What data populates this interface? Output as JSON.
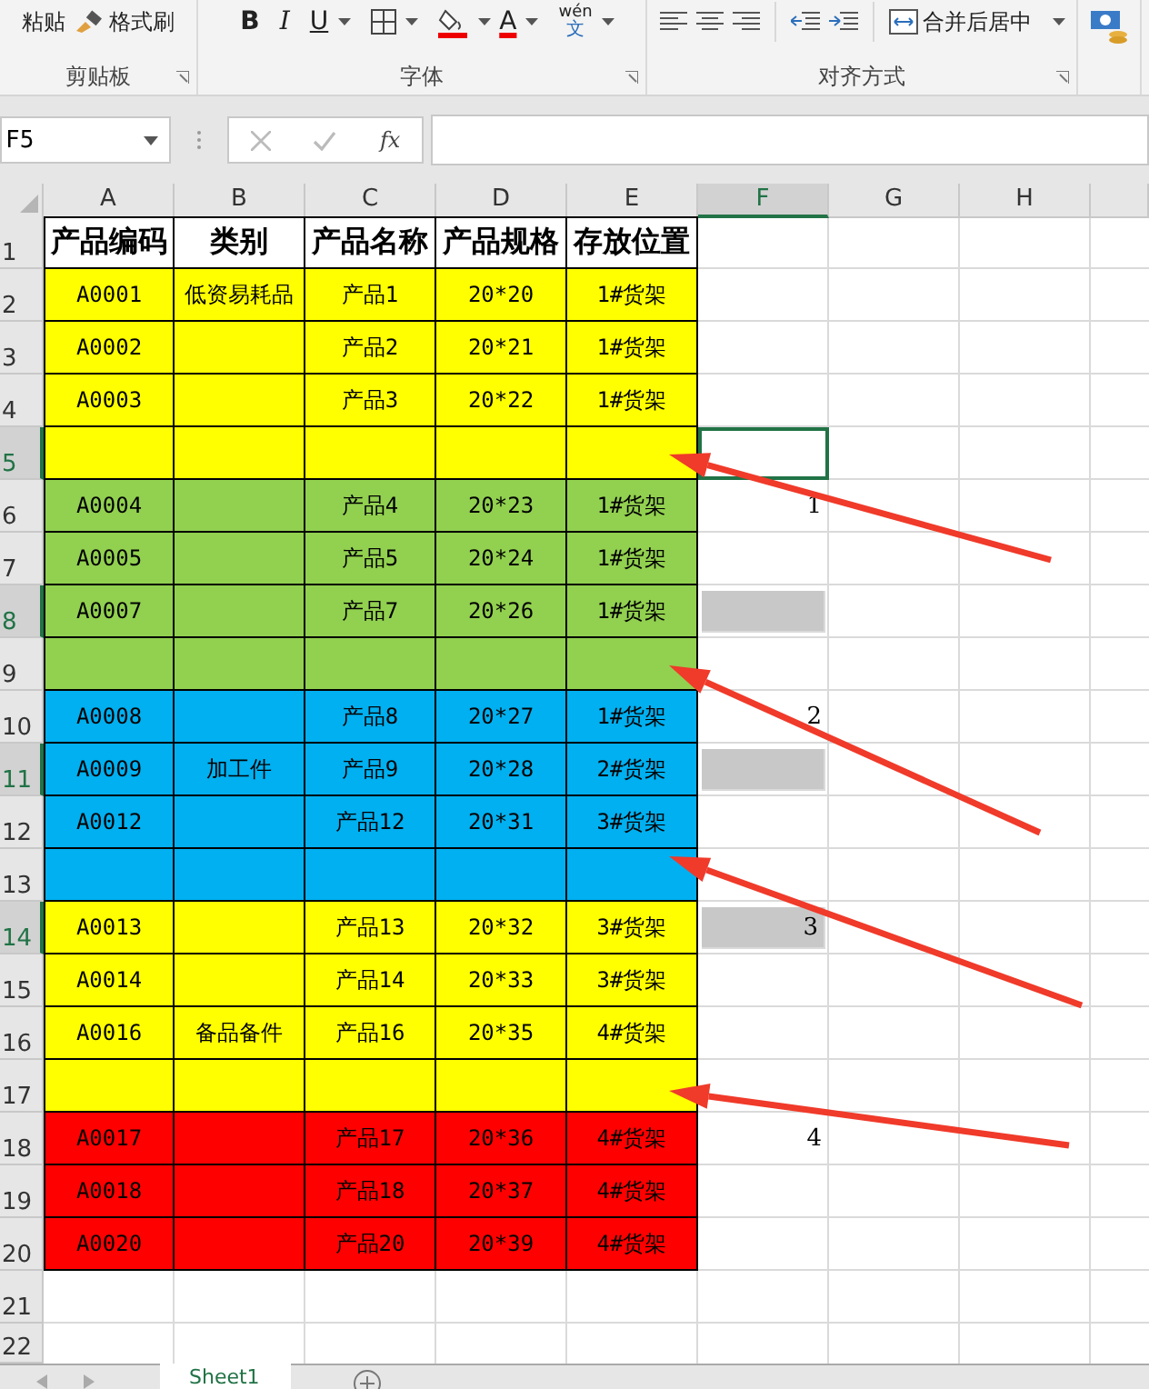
{
  "ribbon": {
    "paste": "粘贴",
    "format_painter": "格式刷",
    "bold": "B",
    "italic": "I",
    "underline": "U",
    "font_color": "A",
    "phonetic": "wén",
    "phonetic_char": "文",
    "merge": "合并后居中",
    "groups": [
      "剪贴板",
      "字体",
      "对齐方式"
    ]
  },
  "formula_bar": {
    "name_box": "F5",
    "function_label": "fx"
  },
  "columns": [
    {
      "label": "A",
      "selected": false
    },
    {
      "label": "B",
      "selected": false
    },
    {
      "label": "C",
      "selected": false
    },
    {
      "label": "D",
      "selected": false
    },
    {
      "label": "E",
      "selected": false
    },
    {
      "label": "F",
      "selected": true
    },
    {
      "label": "G",
      "selected": false
    },
    {
      "label": "H",
      "selected": false
    }
  ],
  "header_row": {
    "number": "1",
    "cells": [
      "产品编码",
      "类别",
      "产品名称",
      "产品规格",
      "存放位置"
    ]
  },
  "rows": [
    {
      "number": "2",
      "color": "#ffff00",
      "a": "A0001",
      "b": "低资易耗品",
      "c": "产品1",
      "d": "20*20",
      "e": "1#货架",
      "selected": false,
      "f_active": false,
      "f_shaded": false,
      "arrow": false
    },
    {
      "number": "3",
      "color": "#ffff00",
      "a": "A0002",
      "c": "产品2",
      "d": "20*21",
      "e": "1#货架",
      "selected": false,
      "f_active": false,
      "f_shaded": false,
      "arrow": false
    },
    {
      "number": "4",
      "color": "#ffff00",
      "a": "A0003",
      "c": "产品3",
      "d": "20*22",
      "e": "1#货架",
      "selected": false,
      "f_active": false,
      "f_shaded": false,
      "arrow": false
    },
    {
      "number": "5",
      "color": "#ffff00",
      "selected": true,
      "f_active": true,
      "f_shaded": false,
      "arrow": true
    },
    {
      "number": "6",
      "color": "#92d050",
      "a": "A0004",
      "c": "产品4",
      "d": "20*23",
      "e": "1#货架",
      "f": "1",
      "selected": false,
      "f_active": false,
      "f_shaded": false,
      "arrow": false
    },
    {
      "number": "7",
      "color": "#92d050",
      "a": "A0005",
      "c": "产品5",
      "d": "20*24",
      "e": "1#货架",
      "selected": false,
      "f_active": false,
      "f_shaded": false,
      "arrow": false
    },
    {
      "number": "8",
      "color": "#92d050",
      "a": "A0007",
      "c": "产品7",
      "d": "20*26",
      "e": "1#货架",
      "selected": true,
      "f_active": false,
      "f_shaded": true,
      "arrow": false
    },
    {
      "number": "9",
      "color": "#92d050",
      "selected": false,
      "f_active": false,
      "f_shaded": false,
      "arrow": true
    },
    {
      "number": "10",
      "color": "#00b0f0",
      "a": "A0008",
      "c": "产品8",
      "d": "20*27",
      "e": "1#货架",
      "f": "2",
      "selected": false,
      "f_active": false,
      "f_shaded": false,
      "arrow": false
    },
    {
      "number": "11",
      "color": "#00b0f0",
      "a": "A0009",
      "b": "加工件",
      "c": "产品9",
      "d": "20*28",
      "e": "2#货架",
      "selected": true,
      "f_active": false,
      "f_shaded": true,
      "arrow": false
    },
    {
      "number": "12",
      "color": "#00b0f0",
      "a": "A0012",
      "c": "产品12",
      "d": "20*31",
      "e": "3#货架",
      "selected": false,
      "f_active": false,
      "f_shaded": false,
      "arrow": false
    },
    {
      "number": "13",
      "color": "#00b0f0",
      "selected": false,
      "f_active": false,
      "f_shaded": false,
      "arrow": true
    },
    {
      "number": "14",
      "color": "#ffff00",
      "a": "A0013",
      "c": "产品13",
      "d": "20*32",
      "e": "3#货架",
      "f": "3",
      "selected": true,
      "f_active": false,
      "f_shaded": true,
      "arrow": false
    },
    {
      "number": "15",
      "color": "#ffff00",
      "a": "A0014",
      "c": "产品14",
      "d": "20*33",
      "e": "3#货架",
      "selected": false,
      "f_active": false,
      "f_shaded": false,
      "arrow": false
    },
    {
      "number": "16",
      "color": "#ffff00",
      "a": "A0016",
      "b": "备品备件",
      "c": "产品16",
      "d": "20*35",
      "e": "4#货架",
      "selected": false,
      "f_active": false,
      "f_shaded": false,
      "arrow": false
    },
    {
      "number": "17",
      "color": "#ffff00",
      "selected": false,
      "f_active": false,
      "f_shaded": false,
      "arrow": true
    },
    {
      "number": "18",
      "color": "#ff0000",
      "a": "A0017",
      "c": "产品17",
      "d": "20*36",
      "e": "4#货架",
      "f": "4",
      "selected": false,
      "f_active": false,
      "f_shaded": false,
      "arrow": false
    },
    {
      "number": "19",
      "color": "#ff0000",
      "a": "A0018",
      "c": "产品18",
      "d": "20*37",
      "e": "4#货架",
      "selected": false,
      "f_active": false,
      "f_shaded": false,
      "arrow": false
    },
    {
      "number": "20",
      "color": "#ff0000",
      "a": "A0020",
      "c": "产品20",
      "d": "20*39",
      "e": "4#货架",
      "selected": false,
      "f_active": false,
      "f_shaded": false,
      "arrow": false
    }
  ],
  "empty_rows": [
    "21",
    "22"
  ],
  "sheet_tabs": [
    {
      "label": "Sheet1",
      "selected": true
    }
  ]
}
